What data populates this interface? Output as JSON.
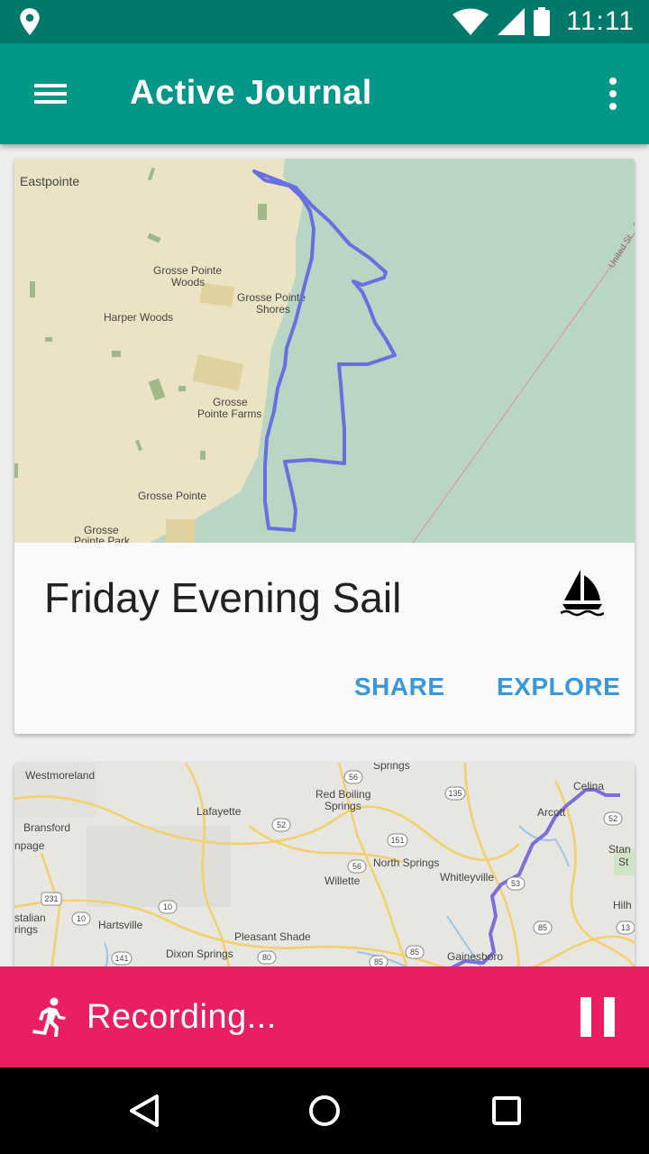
{
  "status_bar": {
    "time": "11:11",
    "icons": [
      "location-icon",
      "wifi-icon",
      "signal-icon",
      "battery-icon"
    ]
  },
  "app_bar": {
    "title": "Active Journal",
    "menu_icon": "hamburger-menu-icon",
    "more_icon": "more-vert-icon"
  },
  "cards": [
    {
      "title": "Friday Evening Sail",
      "activity_icon": "sailboat-icon",
      "actions": {
        "share": "SHARE",
        "explore": "EXPLORE"
      },
      "map_labels": {
        "eastpointe": "Eastpointe",
        "gp_woods_1": "Grosse Pointe",
        "gp_woods_2": "Woods",
        "gp_shores_1": "Grosse Pointe",
        "gp_shores_2": "Shores",
        "harper_woods": "Harper Woods",
        "gp_farms_1": "Grosse",
        "gp_farms_2": "Pointe Farms",
        "grosse_pointe": "Grosse Pointe",
        "gp_park_1": "Grosse",
        "gp_park_2": "Pointe Park",
        "border": "United St... Ca..."
      }
    },
    {
      "map_labels": {
        "westmoreland": "Westmoreland",
        "springs": "Springs",
        "celina": "Celina",
        "red_boiling_1": "Red Boiling",
        "red_boiling_2": "Springs",
        "lafayette": "Lafayette",
        "arcot": "Arcott",
        "bransford": "Bransford",
        "npage": "npage",
        "north_springs": "North Springs",
        "willette": "Willette",
        "whitleyville": "Whitleyville",
        "stan_1": "Stan",
        "stan_2": "St",
        "hilh": "Hilh",
        "stallian_1": "stalian",
        "stallian_2": "rings",
        "hartsville": "Hartsville",
        "pleasant_shade": "Pleasant Shade",
        "dixon_springs": "Dixon Springs",
        "gainesboro": "Gainesboro",
        "r56a": "56",
        "r135": "135",
        "r52a": "52",
        "r52b": "52",
        "r151": "151",
        "r56b": "56",
        "r53": "53",
        "r231": "231",
        "r10a": "10",
        "r10b": "10",
        "r85a": "85",
        "r85b": "85",
        "r85c": "85",
        "r141": "141",
        "r80": "80",
        "r13": "13"
      }
    }
  ],
  "recording_bar": {
    "label": "Recording...",
    "run_icon": "directions-run-icon",
    "pause_icon": "pause-icon"
  },
  "nav_bar": {
    "icons": [
      "back-icon",
      "home-icon",
      "recents-icon"
    ]
  },
  "colors": {
    "primary": "#009688",
    "primary_dark": "#00796b",
    "accent_recording": "#e91e63",
    "action_blue": "#3a97d9",
    "route": "#6870e0"
  }
}
